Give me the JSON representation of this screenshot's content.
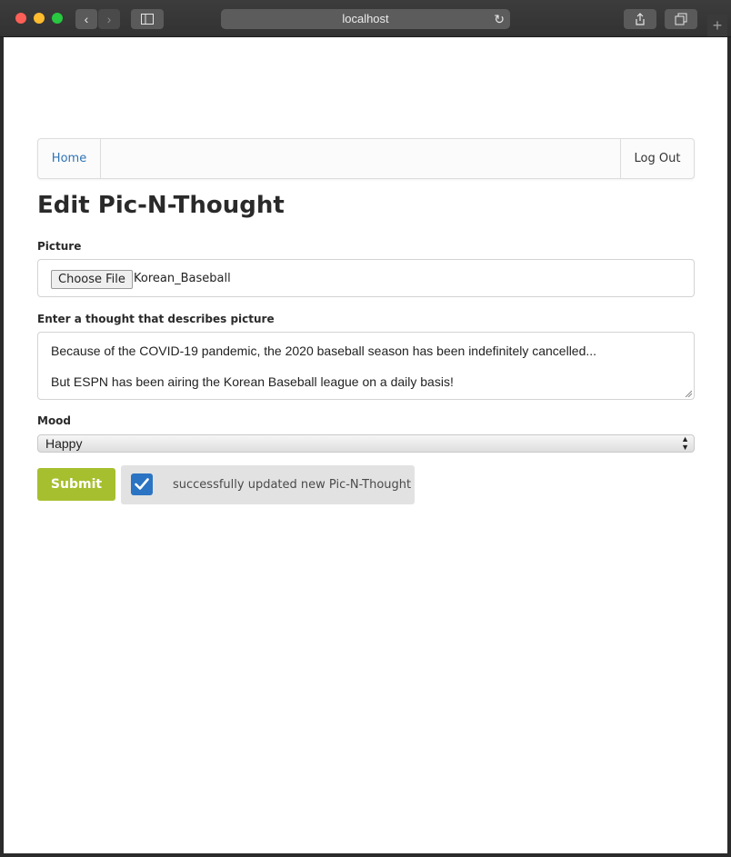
{
  "browser": {
    "url": "localhost",
    "icons": [
      "back-icon",
      "forward-icon",
      "sidebar-icon",
      "reload-icon",
      "share-icon",
      "tabs-icon",
      "new-tab-icon"
    ]
  },
  "nav": {
    "home": "Home",
    "logout": "Log Out"
  },
  "page": {
    "title": "Edit Pic-N-Thought"
  },
  "form": {
    "picture_label": "Picture",
    "choose_file": "Choose File",
    "file_name": "Korean_Baseball",
    "thought_label": "Enter a thought that describes picture",
    "thought_line1": "Because of the COVID-19 pandemic, the 2020 baseball season has been indefinitely cancelled...",
    "thought_line2": "But ESPN has been airing the Korean Baseball league on a daily basis!",
    "mood_label": "Mood",
    "mood_value": "Happy",
    "submit": "Submit"
  },
  "toast": {
    "message": "successfully updated new Pic-N-Thought"
  },
  "colors": {
    "link": "#2f74b5",
    "submit": "#a6bf2f",
    "check": "#2b74c3",
    "toast_bg": "#e2e2e2"
  }
}
